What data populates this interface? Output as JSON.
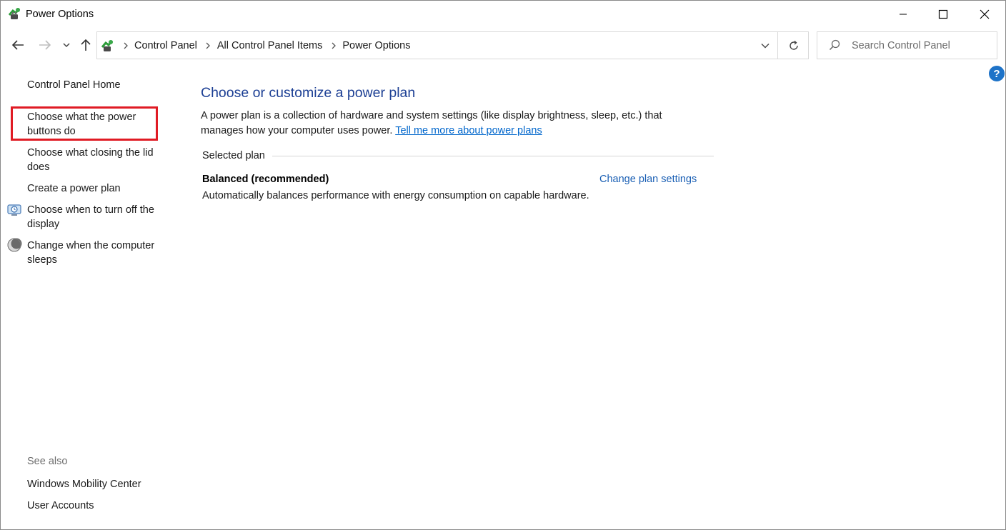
{
  "window": {
    "title": "Power Options"
  },
  "address_bar": {
    "crumbs": [
      "Control Panel",
      "All Control Panel Items",
      "Power Options"
    ]
  },
  "search": {
    "placeholder": "Search Control Panel"
  },
  "help": {
    "label": "?"
  },
  "left_pane": {
    "home_link": "Control Panel Home",
    "tasks": [
      {
        "label": "Choose what the power buttons do",
        "icon": "none",
        "highlighted": true
      },
      {
        "label": "Choose what closing the lid does",
        "icon": "none"
      },
      {
        "label": "Create a power plan",
        "icon": "none"
      },
      {
        "label": "Choose when to turn off the display",
        "icon": "display-power-icon"
      },
      {
        "label": "Change when the computer sleeps",
        "icon": "sleep-moon-icon"
      }
    ],
    "see_also_label": "See also",
    "see_also": [
      "Windows Mobility Center",
      "User Accounts"
    ]
  },
  "main": {
    "title": "Choose or customize a power plan",
    "description": "A power plan is a collection of hardware and system settings (like display brightness, sleep, etc.) that manages how your computer uses power.",
    "learn_more_link": "Tell me more about power plans",
    "selected_plan_label": "Selected plan",
    "plan": {
      "name": "Balanced (recommended)",
      "change_link": "Change plan settings",
      "description": "Automatically balances performance with energy consumption on capable hardware."
    }
  },
  "colors": {
    "title_blue": "#1c3f94",
    "link_blue": "#0066cc",
    "highlight_red": "#e01b24",
    "help_blue": "#1e73c8"
  }
}
